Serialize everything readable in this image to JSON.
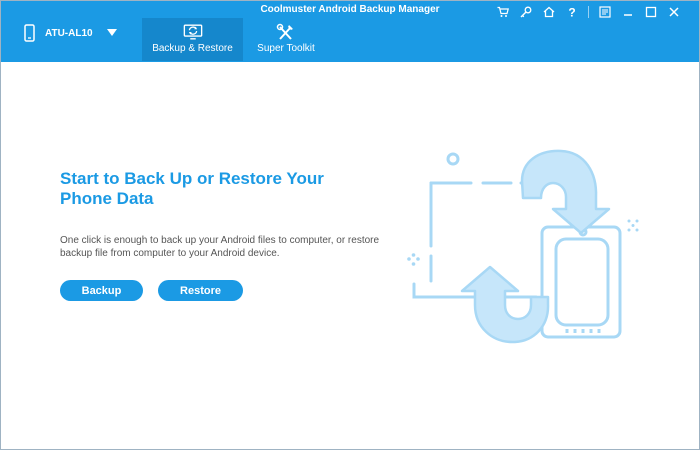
{
  "window": {
    "title": "Coolmuster Android Backup Manager"
  },
  "device": {
    "name": "ATU-AL10"
  },
  "nav": {
    "tabs": [
      {
        "label": "Backup & Restore",
        "active": true
      },
      {
        "label": "Super Toolkit",
        "active": false
      }
    ]
  },
  "toolbar_icons": [
    "cart-icon",
    "key-icon",
    "home-icon",
    "help-icon",
    "feedback-icon",
    "minimize-icon",
    "maximize-icon",
    "close-icon"
  ],
  "main": {
    "headline": "Start to Back Up or Restore Your Phone Data",
    "description": "One click is enough to back up your Android files to computer, or restore backup file from computer to your Android device.",
    "backup_label": "Backup",
    "restore_label": "Restore"
  },
  "colors": {
    "header": "#1b9ae4",
    "tab_active": "#1587cc",
    "accent": "#1b9ae4",
    "illustration": "#a8d8f5"
  }
}
